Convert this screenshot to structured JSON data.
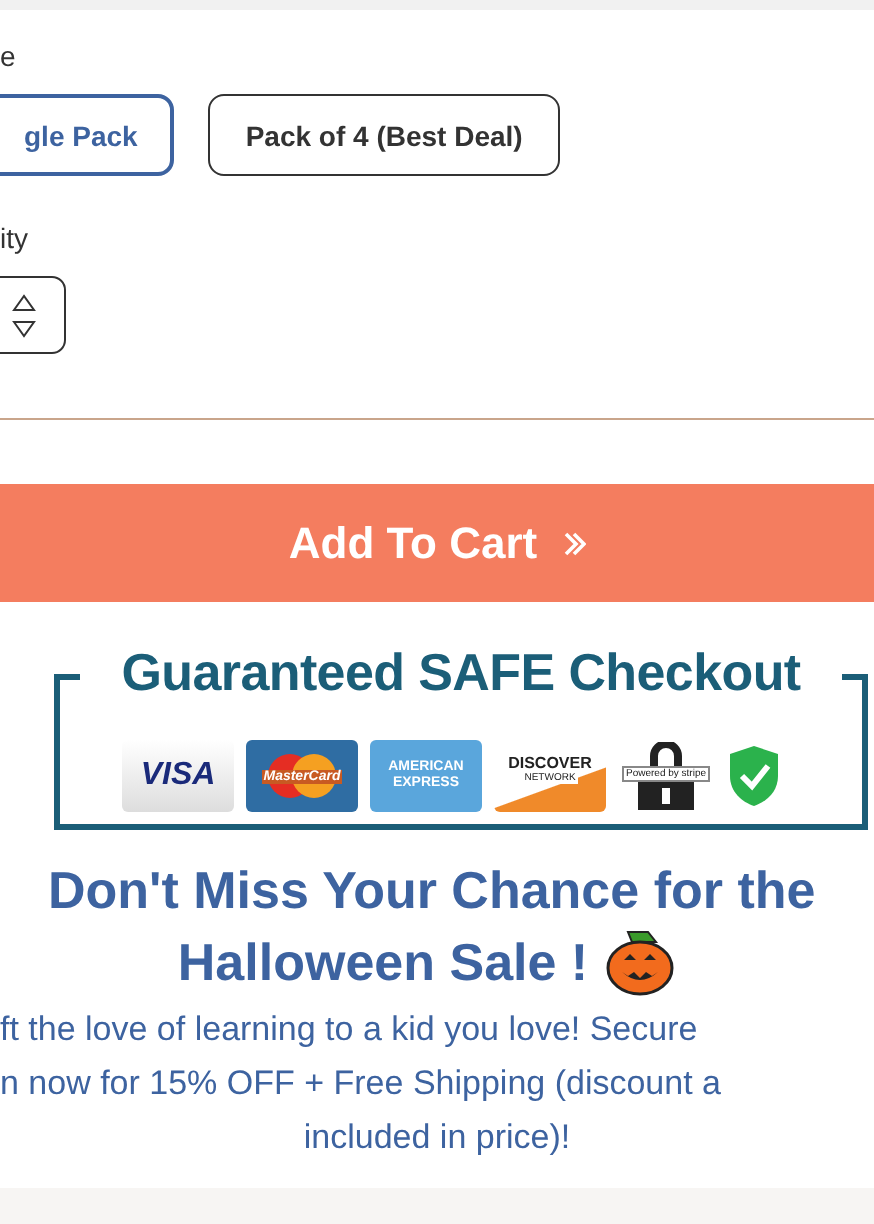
{
  "size": {
    "label": "e",
    "options": [
      {
        "label": "gle Pack",
        "selected": true
      },
      {
        "label": "Pack of 4 (Best Deal)",
        "selected": false
      }
    ]
  },
  "quantity": {
    "label": "ity"
  },
  "add_to_cart": {
    "label": "Add To Cart"
  },
  "checkout_badge": {
    "title": "Guaranteed SAFE Checkout",
    "logos": [
      {
        "kind": "visa",
        "label": "VISA"
      },
      {
        "kind": "mastercard",
        "label": "MasterCard"
      },
      {
        "kind": "amex",
        "label": "AMERICAN EXPRESS"
      },
      {
        "kind": "discover",
        "label": "DISCOVER",
        "sublabel": "NETWORK"
      },
      {
        "kind": "stripe",
        "label": "Powered by stripe"
      },
      {
        "kind": "shield"
      }
    ]
  },
  "promo": {
    "heading_lines": [
      "Don't Miss Your Chance for the",
      "Halloween Sale !"
    ],
    "body_lines": [
      "ft the love of learning to a kid you love! Secure",
      "n now for 15% OFF + Free Shipping (discount a",
      "included in price)!"
    ]
  }
}
